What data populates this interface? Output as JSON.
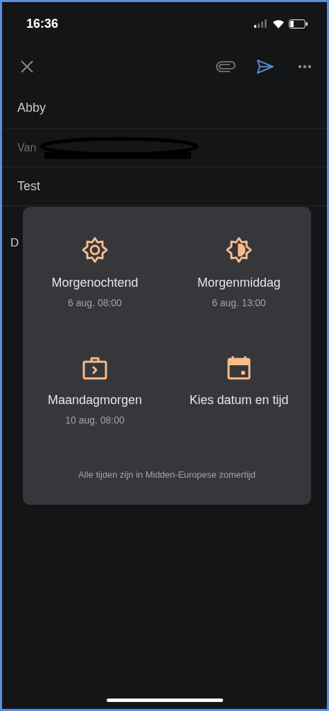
{
  "status_bar": {
    "time": "16:36"
  },
  "compose": {
    "to": "Abby",
    "from_label": "Van",
    "subject": "Test",
    "body": "D"
  },
  "schedule_dialog": {
    "options": [
      {
        "kind": "sun",
        "label": "Morgenochtend",
        "time": "6 aug. 08:00"
      },
      {
        "kind": "half-sun",
        "label": "Morgenmiddag",
        "time": "6 aug. 13:00"
      },
      {
        "kind": "briefcase",
        "label": "Maandagmorgen",
        "time": "10 aug. 08:00"
      },
      {
        "kind": "calendar",
        "label": "Kies datum en tijd"
      }
    ],
    "footnote": "Alle tijden zijn in Midden-Europese zomertijd"
  }
}
